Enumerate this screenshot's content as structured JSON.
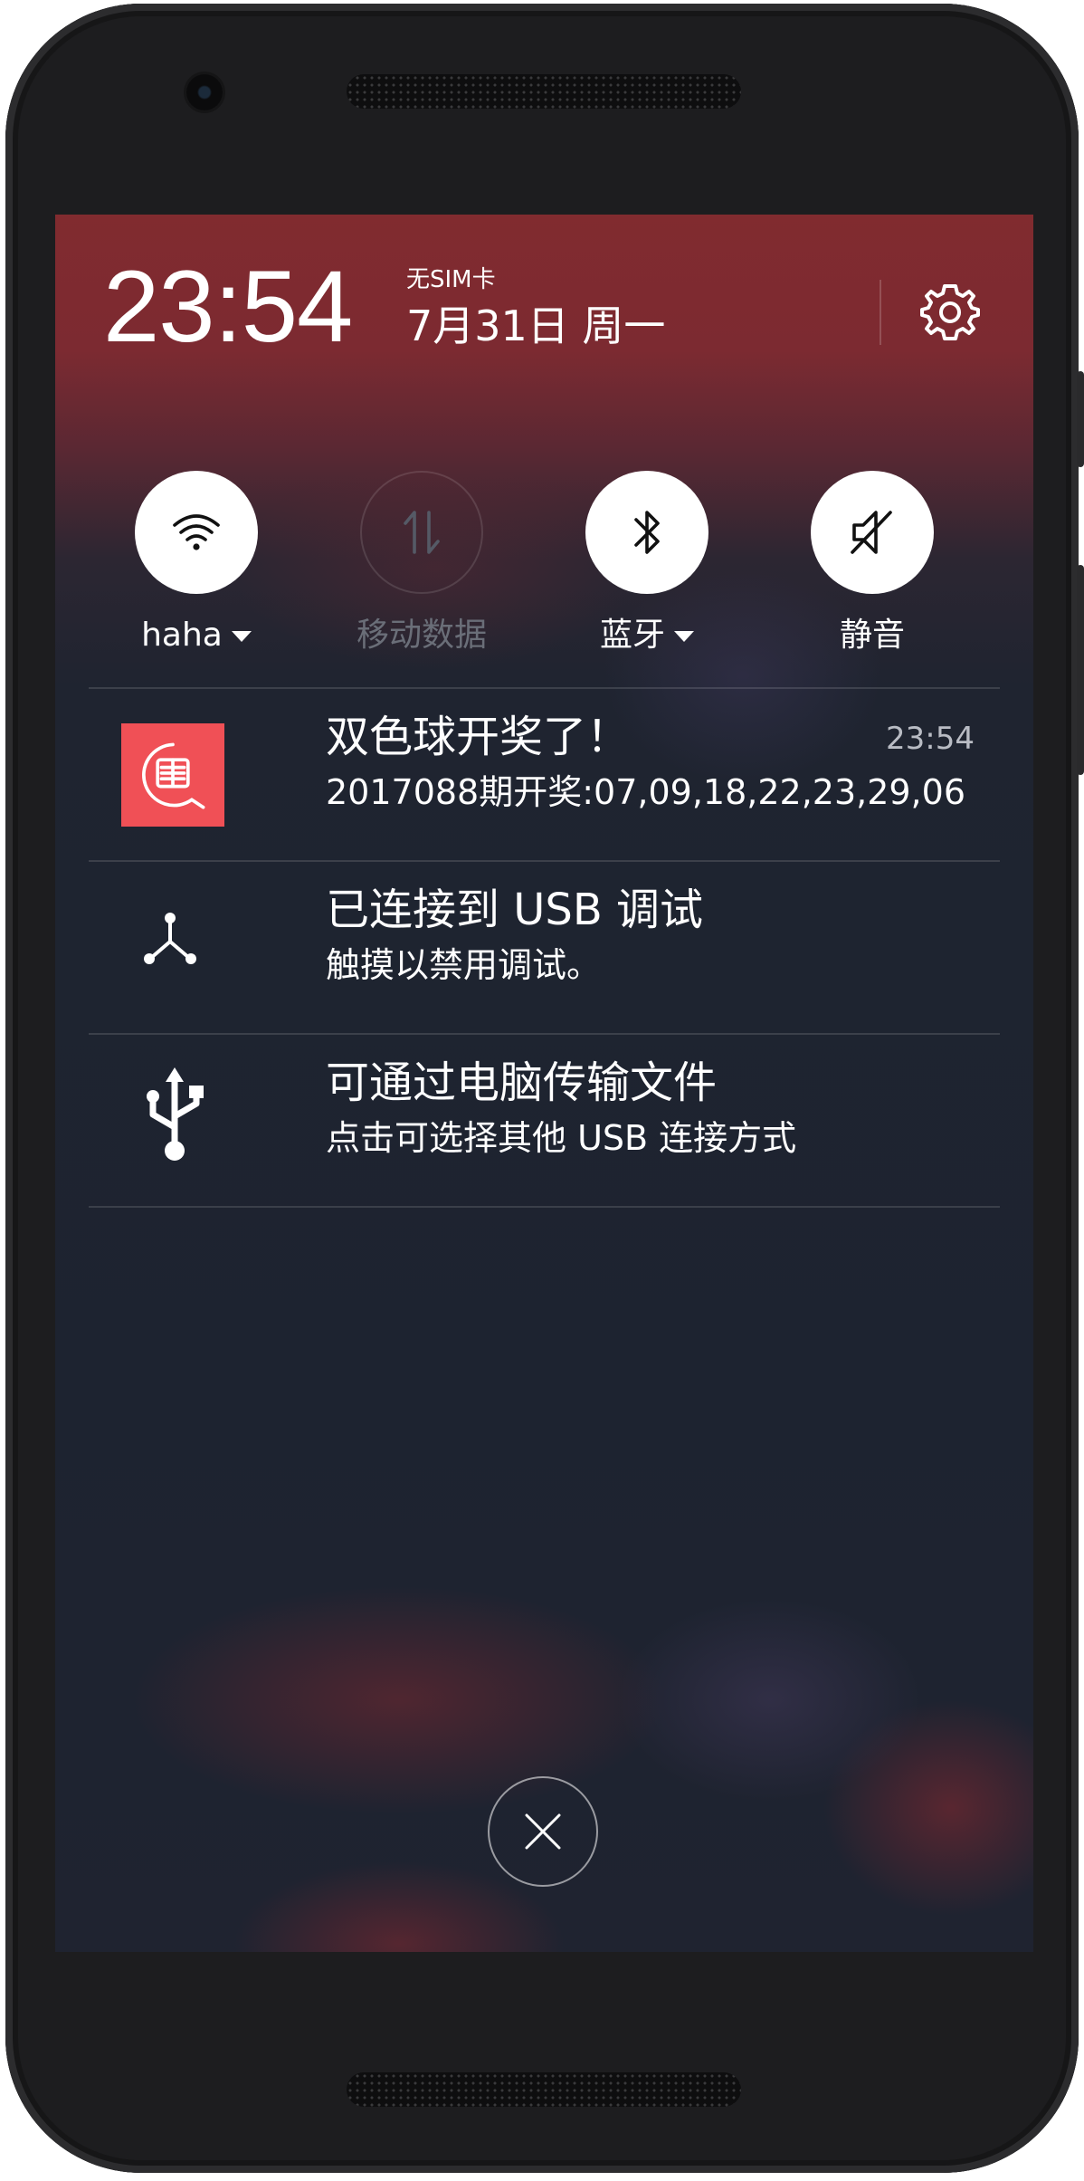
{
  "status": {
    "time": "23:54",
    "sim": "无SIM卡",
    "date": "7月31日 周一"
  },
  "quick_toggles": [
    {
      "label": "haha",
      "icon": "wifi-icon",
      "active": true,
      "has_dropdown": true
    },
    {
      "label": "移动数据",
      "icon": "mobile-data-icon",
      "active": false,
      "has_dropdown": false
    },
    {
      "label": "蓝牙",
      "icon": "bluetooth-icon",
      "active": true,
      "has_dropdown": true
    },
    {
      "label": "静音",
      "icon": "mute-icon",
      "active": true,
      "has_dropdown": false
    }
  ],
  "notifications": [
    {
      "title": "双色球开奖了！",
      "subtitle": "2017088期开奖:07,09,18,22,23,29,06",
      "time": "23:54",
      "icon": "lottery-app-icon"
    },
    {
      "title": "已连接到 USB 调试",
      "subtitle": "触摸以禁用调试。",
      "icon": "usb-debug-icon"
    },
    {
      "title": "可通过电脑传输文件",
      "subtitle": "点击可选择其他 USB 连接方式",
      "icon": "usb-icon"
    }
  ],
  "colors": {
    "panel_top": "#812b2f",
    "panel_bottom": "#1d2330",
    "app_icon_bg": "#f05056",
    "inactive_label": "#6a6e78"
  }
}
